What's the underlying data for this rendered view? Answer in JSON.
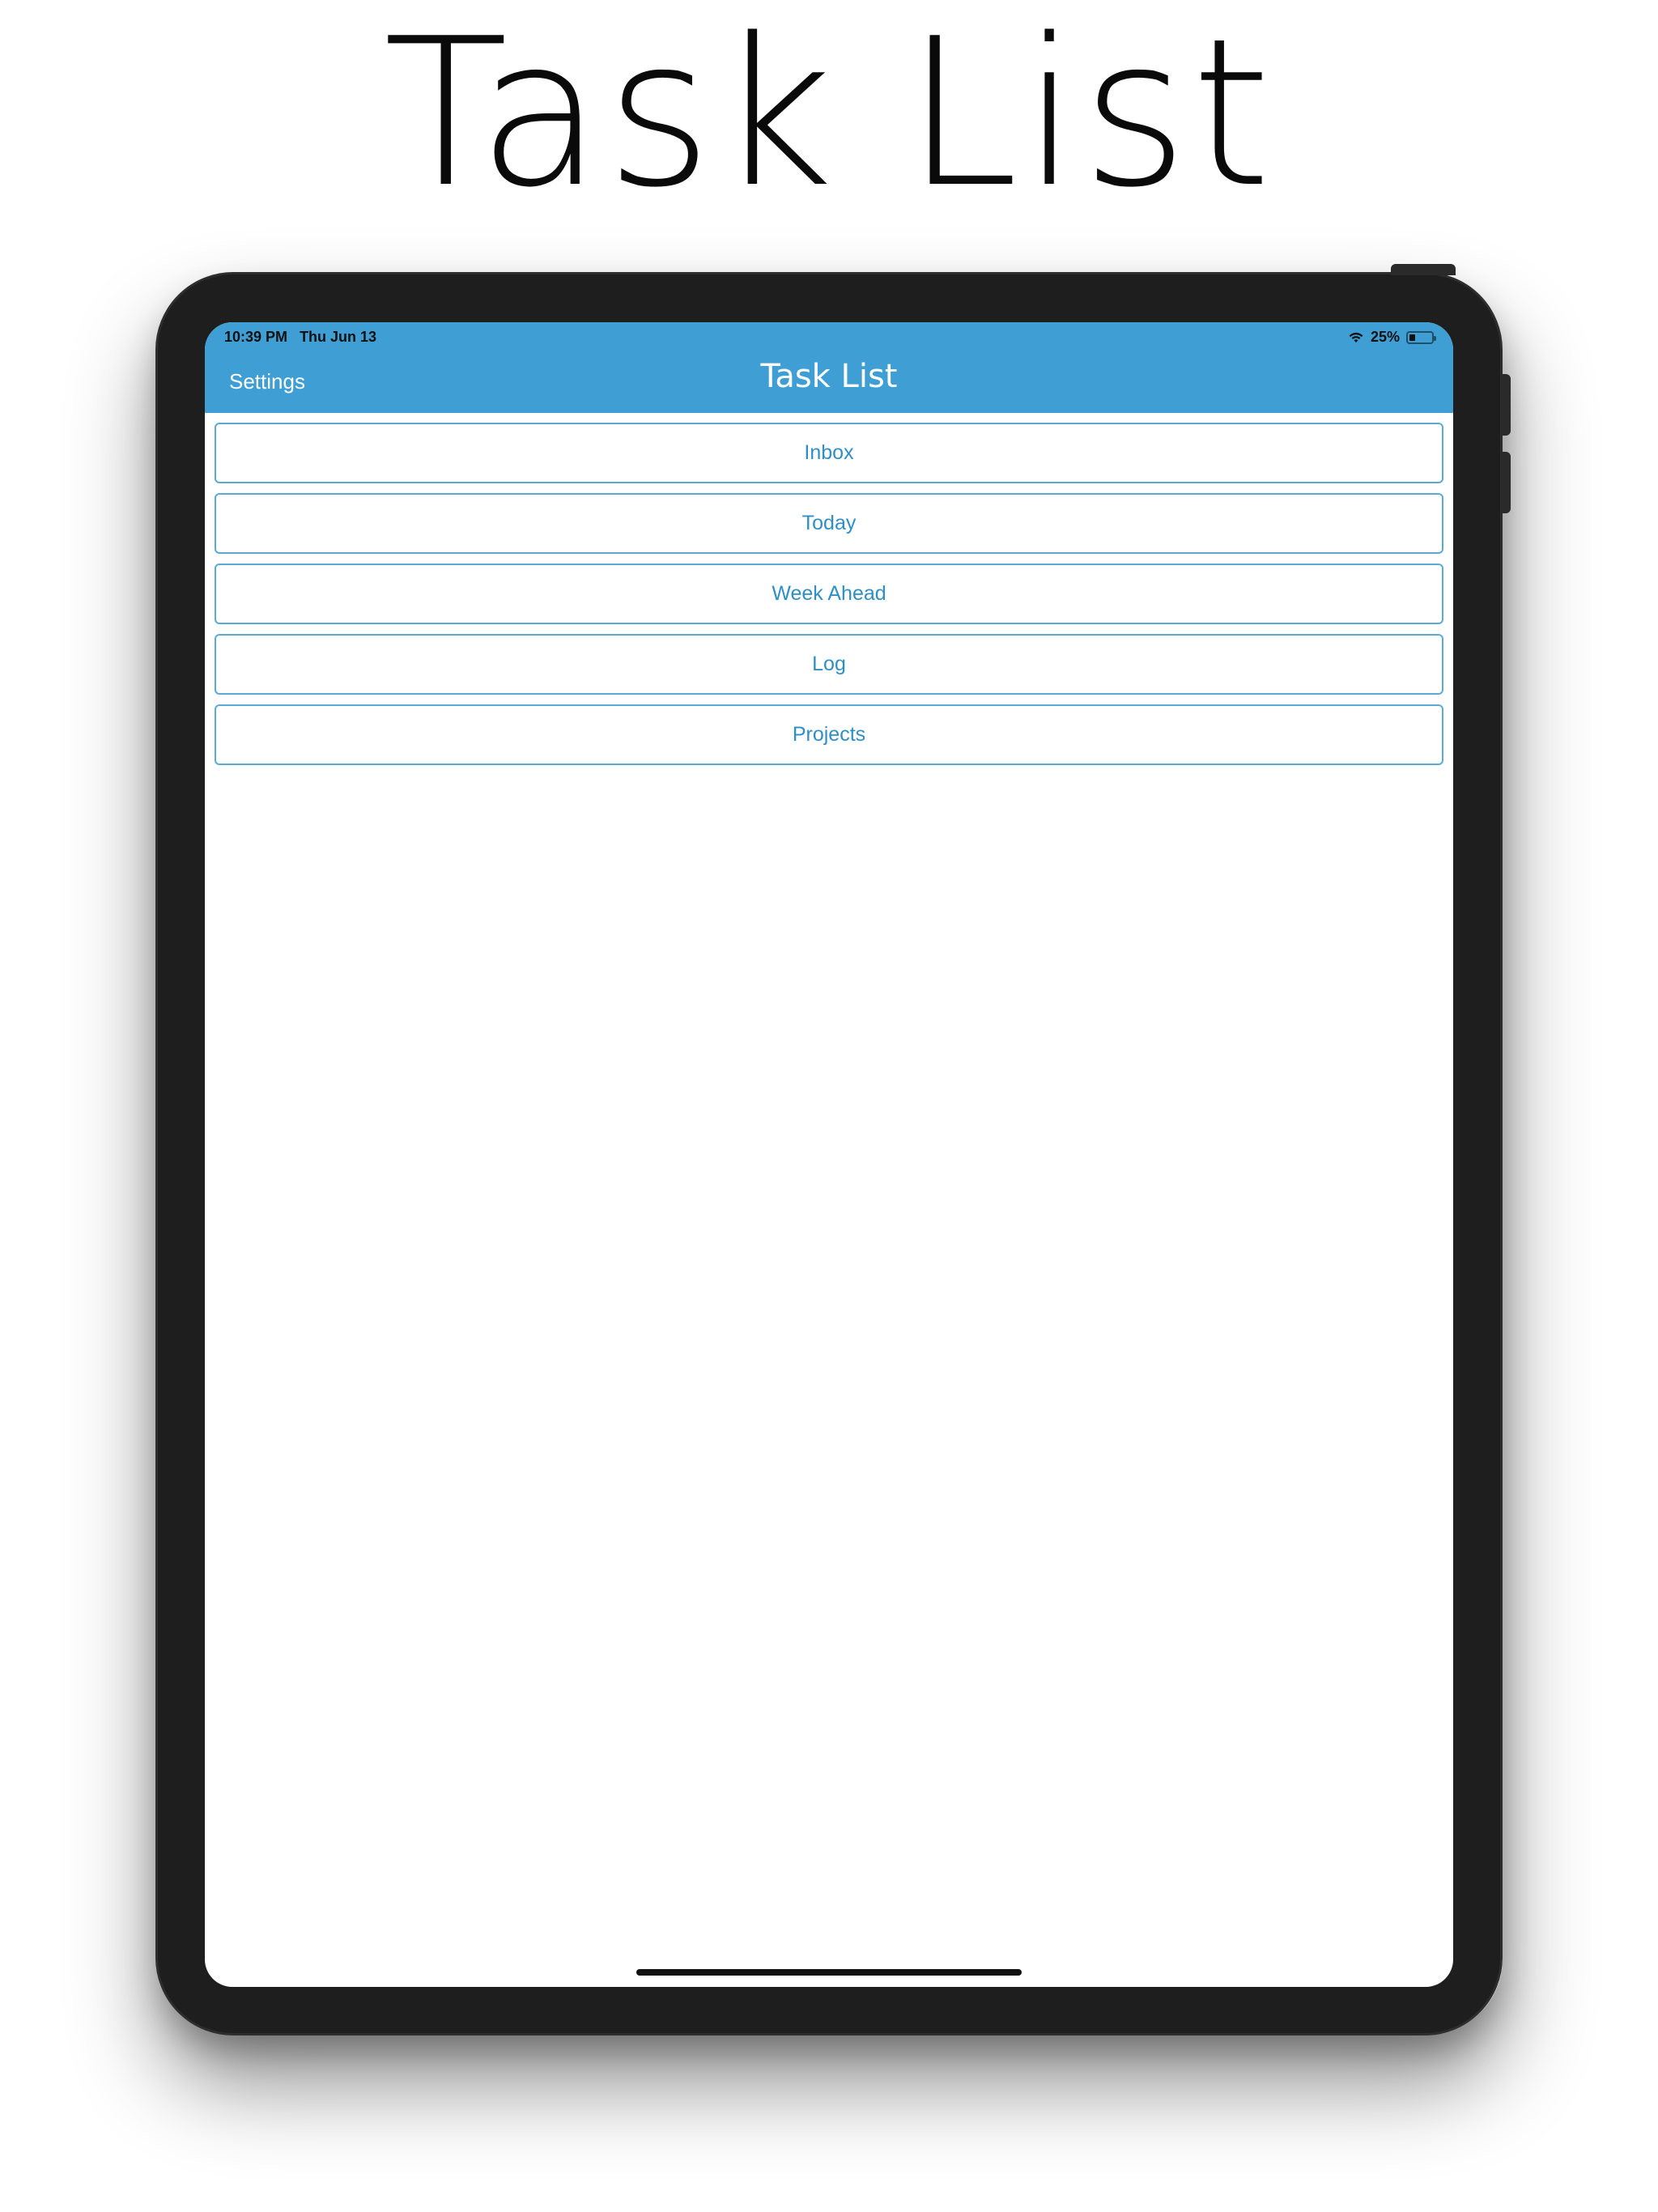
{
  "headline": {
    "text": "Task List"
  },
  "status_bar": {
    "time": "10:39 PM",
    "date": "Thu Jun 13",
    "battery": "25%",
    "battery_level": 0.25,
    "wifi_icon": "wifi-icon",
    "battery_icon": "battery-icon"
  },
  "navbar": {
    "background_color": "#3f9ed3",
    "left_button": "Settings",
    "title": "Task List"
  },
  "menu": {
    "accent_color": "#2f8fc4",
    "items": [
      {
        "label": "Inbox"
      },
      {
        "label": "Today"
      },
      {
        "label": "Week Ahead"
      },
      {
        "label": "Log"
      },
      {
        "label": "Projects"
      }
    ]
  }
}
